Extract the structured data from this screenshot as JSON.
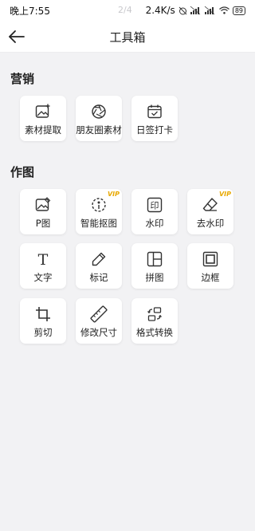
{
  "status_bar": {
    "time": "晚上7:55",
    "page_indicator": "2/4",
    "network_speed": "2.4K/s",
    "battery": "89"
  },
  "header": {
    "title": "工具箱"
  },
  "sections": [
    {
      "title": "营销",
      "tools": [
        {
          "label": "素材提取",
          "icon": "image-plus-icon"
        },
        {
          "label": "朋友圈素材",
          "icon": "aperture-icon"
        },
        {
          "label": "日签打卡",
          "icon": "calendar-check-icon"
        }
      ]
    },
    {
      "title": "作图",
      "tools": [
        {
          "label": "P图",
          "icon": "image-edit-icon"
        },
        {
          "label": "智能抠图",
          "icon": "smart-cutout-icon",
          "badge": "VIP"
        },
        {
          "label": "水印",
          "icon": "seal-icon",
          "icon_text": "印"
        },
        {
          "label": "去水印",
          "icon": "eraser-icon",
          "badge": "VIP"
        },
        {
          "label": "文字",
          "icon": "text-icon",
          "icon_text": "T"
        },
        {
          "label": "标记",
          "icon": "pen-icon"
        },
        {
          "label": "拼图",
          "icon": "collage-icon"
        },
        {
          "label": "边框",
          "icon": "frame-icon"
        },
        {
          "label": "剪切",
          "icon": "crop-icon"
        },
        {
          "label": "修改尺寸",
          "icon": "ruler-icon"
        },
        {
          "label": "格式转换",
          "icon": "convert-icon"
        }
      ]
    }
  ],
  "colors": {
    "background": "#f2f2f4",
    "tile": "#ffffff",
    "vip": "#e8a800",
    "text": "#222222"
  }
}
